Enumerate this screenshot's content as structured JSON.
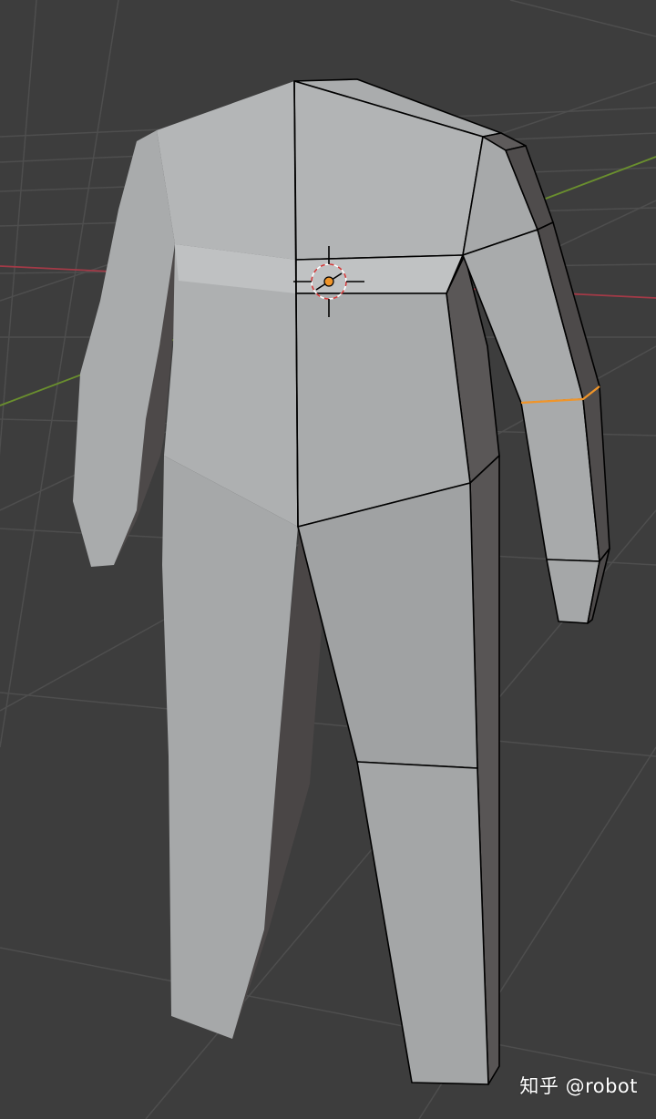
{
  "viewport": {
    "background_color": "#3d3d3d",
    "grid_color": "#4e4e4e",
    "x_axis_color": "#a33a47",
    "y_axis_color": "#6a8f2e",
    "mesh_face_light": "#b7b9ba",
    "mesh_face_mid": "#a4a6a8",
    "mesh_face_dark": "#5d5a5a",
    "mesh_wire_color": "#000000",
    "selected_edge_color": "#f0952a",
    "origin_color": "#f0952a"
  },
  "watermark": {
    "text": "知乎 @robot"
  }
}
